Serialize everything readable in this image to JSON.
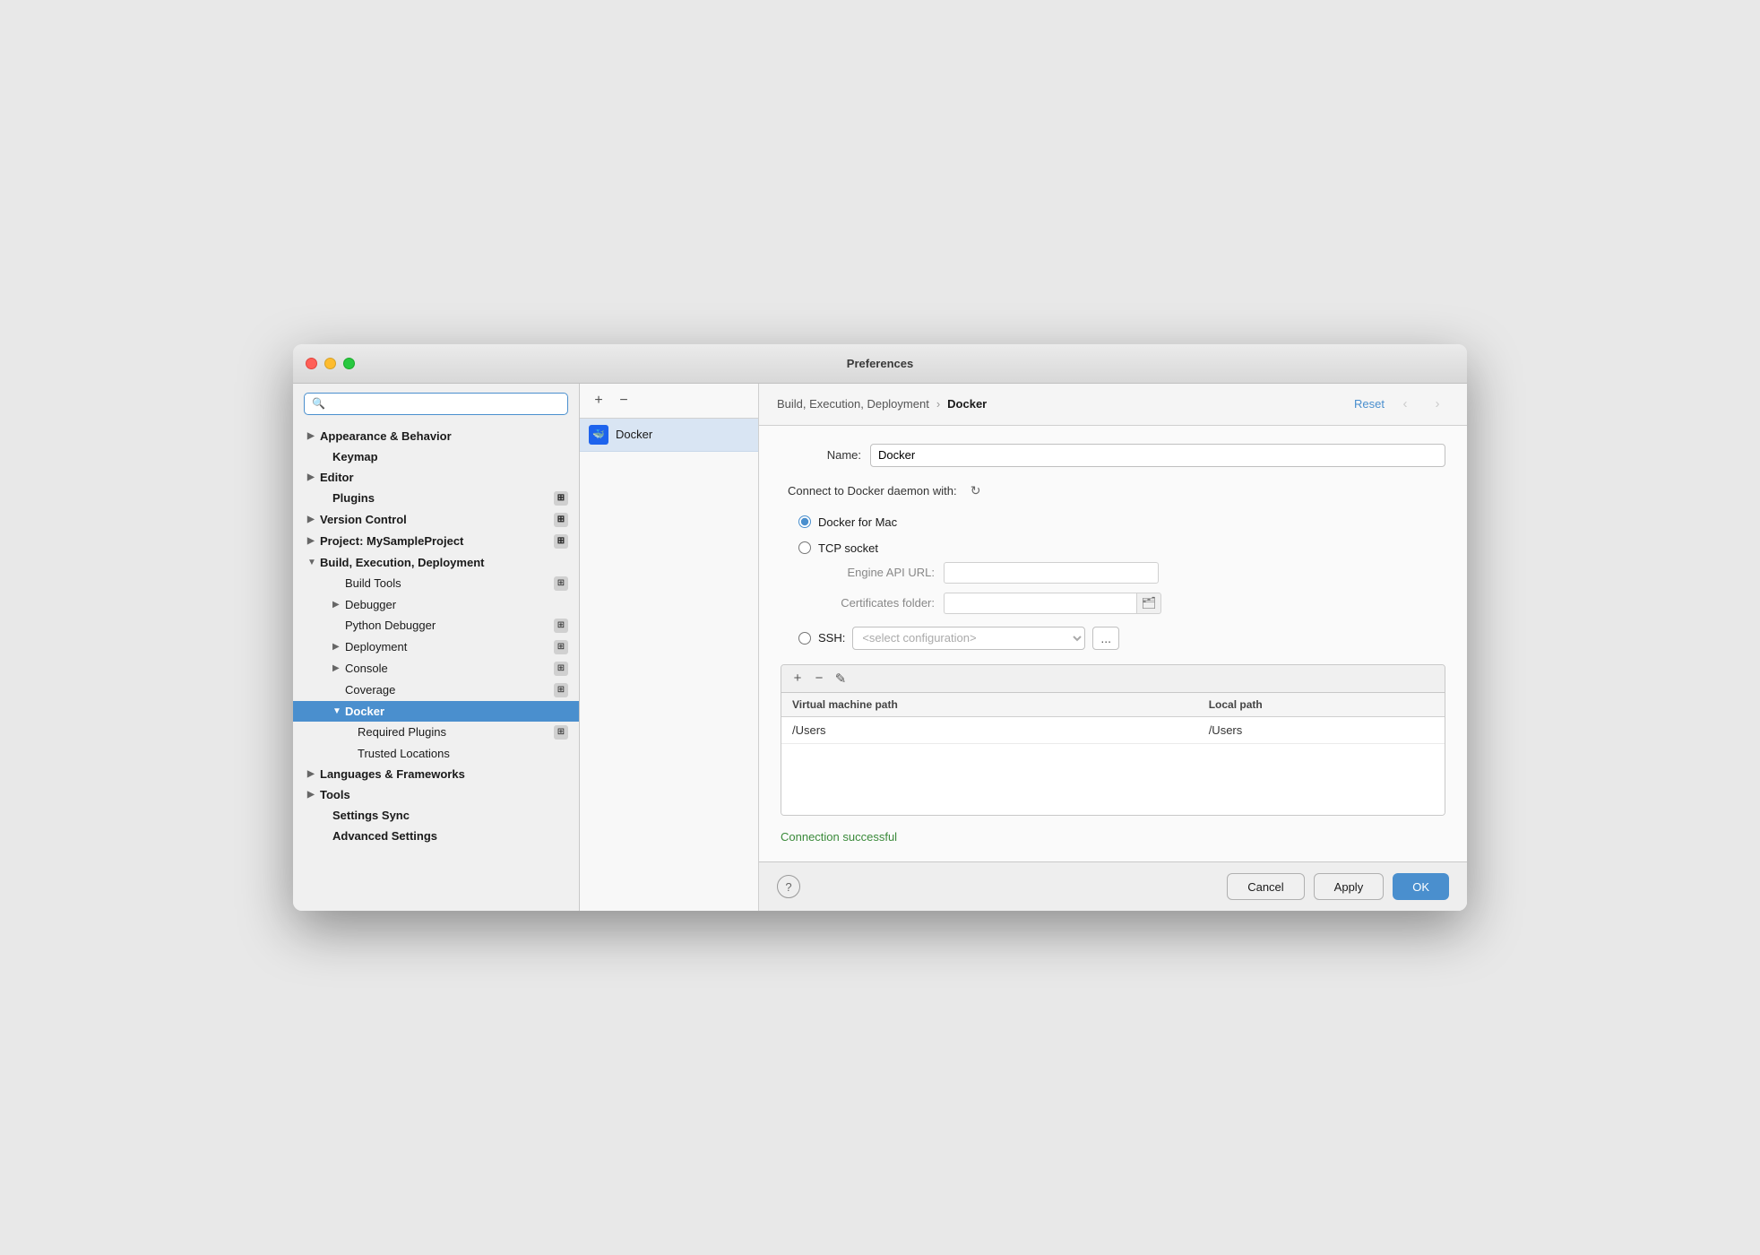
{
  "window": {
    "title": "Preferences"
  },
  "sidebar": {
    "search_placeholder": "🔍",
    "items": [
      {
        "id": "appearance",
        "label": "Appearance & Behavior",
        "level": 0,
        "expanded": true,
        "bold": true,
        "chevron": "▶",
        "badge": false
      },
      {
        "id": "keymap",
        "label": "Keymap",
        "level": 0,
        "expanded": false,
        "bold": true,
        "chevron": "",
        "badge": false
      },
      {
        "id": "editor",
        "label": "Editor",
        "level": 0,
        "expanded": false,
        "bold": true,
        "chevron": "▶",
        "badge": false
      },
      {
        "id": "plugins",
        "label": "Plugins",
        "level": 0,
        "expanded": false,
        "bold": true,
        "chevron": "",
        "badge": true
      },
      {
        "id": "version-control",
        "label": "Version Control",
        "level": 0,
        "expanded": false,
        "bold": true,
        "chevron": "▶",
        "badge": true
      },
      {
        "id": "project",
        "label": "Project: MySampleProject",
        "level": 0,
        "expanded": false,
        "bold": true,
        "chevron": "▶",
        "badge": true
      },
      {
        "id": "build",
        "label": "Build, Execution, Deployment",
        "level": 0,
        "expanded": true,
        "bold": true,
        "chevron": "▼",
        "badge": false
      },
      {
        "id": "build-tools",
        "label": "Build Tools",
        "level": 1,
        "expanded": false,
        "bold": false,
        "chevron": "",
        "badge": true
      },
      {
        "id": "debugger",
        "label": "Debugger",
        "level": 1,
        "expanded": false,
        "bold": false,
        "chevron": "▶",
        "badge": false
      },
      {
        "id": "python-debugger",
        "label": "Python Debugger",
        "level": 1,
        "expanded": false,
        "bold": false,
        "chevron": "",
        "badge": true
      },
      {
        "id": "deployment",
        "label": "Deployment",
        "level": 1,
        "expanded": false,
        "bold": false,
        "chevron": "▶",
        "badge": true
      },
      {
        "id": "console",
        "label": "Console",
        "level": 1,
        "expanded": false,
        "bold": false,
        "chevron": "▶",
        "badge": true
      },
      {
        "id": "coverage",
        "label": "Coverage",
        "level": 1,
        "expanded": false,
        "bold": false,
        "chevron": "",
        "badge": true
      },
      {
        "id": "docker",
        "label": "Docker",
        "level": 1,
        "expanded": true,
        "bold": true,
        "chevron": "▼",
        "badge": false,
        "selected": true
      },
      {
        "id": "required-plugins",
        "label": "Required Plugins",
        "level": 2,
        "expanded": false,
        "bold": false,
        "chevron": "",
        "badge": true
      },
      {
        "id": "trusted-locations",
        "label": "Trusted Locations",
        "level": 2,
        "expanded": false,
        "bold": false,
        "chevron": "",
        "badge": false
      },
      {
        "id": "languages",
        "label": "Languages & Frameworks",
        "level": 0,
        "expanded": false,
        "bold": true,
        "chevron": "▶",
        "badge": false
      },
      {
        "id": "tools",
        "label": "Tools",
        "level": 0,
        "expanded": false,
        "bold": true,
        "chevron": "▶",
        "badge": false
      },
      {
        "id": "settings-sync",
        "label": "Settings Sync",
        "level": 0,
        "expanded": false,
        "bold": true,
        "chevron": "",
        "badge": false
      },
      {
        "id": "advanced-settings",
        "label": "Advanced Settings",
        "level": 0,
        "expanded": false,
        "bold": true,
        "chevron": "",
        "badge": false
      }
    ]
  },
  "middle": {
    "toolbar": {
      "add_label": "+",
      "remove_label": "−"
    },
    "items": [
      {
        "name": "Docker",
        "icon": "🐳"
      }
    ]
  },
  "breadcrumb": {
    "parent": "Build, Execution, Deployment",
    "separator": "›",
    "current": "Docker"
  },
  "header": {
    "reset_label": "Reset",
    "back_label": "‹",
    "forward_label": "›"
  },
  "form": {
    "name_label": "Name:",
    "name_value": "Docker",
    "connect_label": "Connect to Docker daemon with:",
    "docker_mac_label": "Docker for Mac",
    "tcp_socket_label": "TCP socket",
    "engine_api_url_label": "Engine API URL:",
    "engine_api_url_value": "",
    "certificates_folder_label": "Certificates folder:",
    "certificates_folder_value": "",
    "ssh_label": "SSH:",
    "ssh_placeholder": "<select configuration>"
  },
  "table": {
    "toolbar": {
      "add": "+",
      "remove": "−",
      "edit": "✎"
    },
    "columns": [
      "Virtual machine path",
      "Local path"
    ],
    "rows": [
      {
        "vm_path": "/Users",
        "local_path": "/Users"
      }
    ]
  },
  "status": {
    "text": "Connection successful"
  },
  "buttons": {
    "help": "?",
    "cancel": "Cancel",
    "apply": "Apply",
    "ok": "OK"
  }
}
